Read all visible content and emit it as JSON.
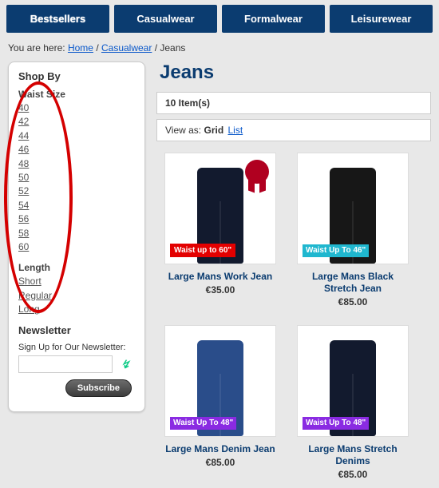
{
  "nav": {
    "items": [
      {
        "label": "Bestsellers"
      },
      {
        "label": "Casualwear"
      },
      {
        "label": "Formalwear"
      },
      {
        "label": "Leisurewear"
      }
    ]
  },
  "breadcrumb": {
    "prefix": "You are here: ",
    "items": [
      "Home",
      "Casualwear"
    ],
    "current": "Jeans"
  },
  "sidebar": {
    "shop_by": "Shop By",
    "waist_title": "Waist Size",
    "waist": [
      "40",
      "42",
      "44",
      "46",
      "48",
      "50",
      "52",
      "54",
      "56",
      "58",
      "60"
    ],
    "length_title": "Length",
    "length": [
      "Short",
      "Regular",
      "Long"
    ],
    "newsletter_title": "Newsletter",
    "newsletter_label": "Sign Up for Our Newsletter:",
    "subscribe": "Subscribe"
  },
  "page": {
    "title": "Jeans",
    "count_text": "10 Item(s)",
    "view_label": "View as:",
    "view_grid": "Grid",
    "view_list": "List"
  },
  "products": [
    {
      "name": "Large Mans Work Jean",
      "price": "€35.00",
      "jean_class": "darknavy",
      "badge_class": "red",
      "badge_text": "Waist up to 60\"",
      "ribbon": true
    },
    {
      "name": "Large Mans Black Stretch Jean",
      "price": "€85.00",
      "jean_class": "black",
      "badge_class": "cyan",
      "badge_text": "Waist Up To 46\"",
      "ribbon": false
    },
    {
      "name": "Large Mans Denim Jean",
      "price": "€85.00",
      "jean_class": "blue",
      "badge_class": "purple",
      "badge_text": "Waist Up To 48\"",
      "ribbon": false
    },
    {
      "name": "Large Mans Stretch Denims",
      "price": "€85.00",
      "jean_class": "darknavy",
      "badge_class": "purple",
      "badge_text": "Waist Up To 48\"",
      "ribbon": false
    }
  ]
}
